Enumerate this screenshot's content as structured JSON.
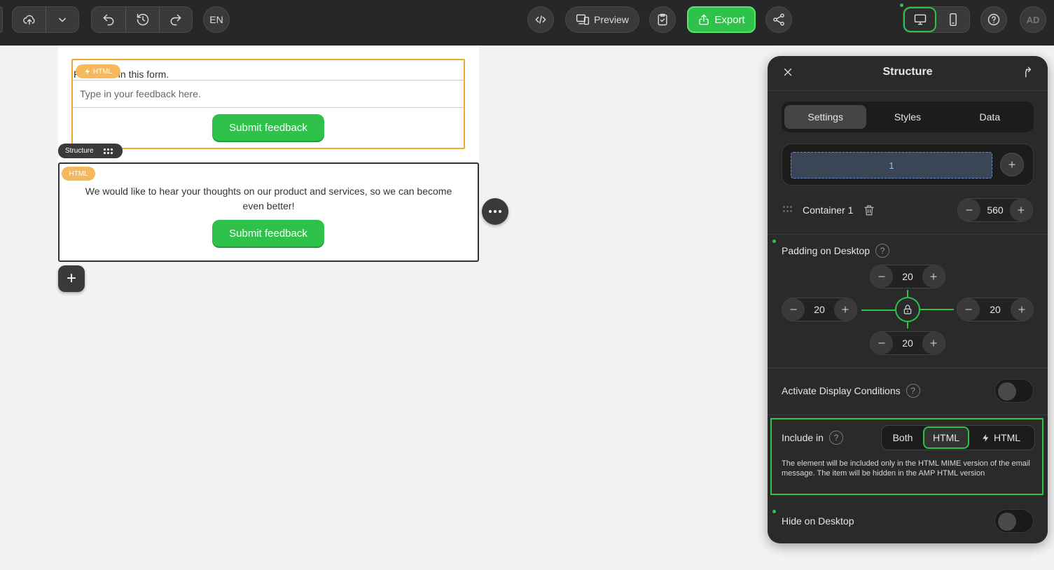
{
  "toolbar": {
    "language": "EN",
    "preview_label": "Preview",
    "export_label": "Export",
    "avatar_initials": "AD"
  },
  "canvas": {
    "block1": {
      "intro_text": "Please fill in this form.",
      "input_placeholder": "Type in your feedback here.",
      "badge_label": "HTML",
      "button_label": "Submit feedback"
    },
    "structure_tag": "Structure",
    "block2": {
      "badge_label": "HTML",
      "text": "We would like to hear your thoughts on our product and services, so we can become even better!",
      "button_label": "Submit feedback"
    }
  },
  "panel": {
    "title": "Structure",
    "tabs": [
      "Settings",
      "Styles",
      "Data"
    ],
    "active_tab": "Settings",
    "column_slot_label": "1",
    "container_label": "Container 1",
    "container_width": "560",
    "padding_label": "Padding on Desktop",
    "padding": {
      "top": "20",
      "left": "20",
      "right": "20",
      "bottom": "20"
    },
    "display_conditions_label": "Activate Display Conditions",
    "include_label": "Include in",
    "include_options": [
      "Both",
      "HTML",
      "HTML"
    ],
    "include_selected": "HTML",
    "include_description": "The element will be included only in the HTML MIME version of the email message. The item will be hidden in the AMP HTML version",
    "hide_desktop_label": "Hide on Desktop"
  },
  "colors": {
    "accent_green": "#2ec24a",
    "selection_orange": "#f0a832",
    "badge_orange": "#f5b85c",
    "topbar_bg": "#272727",
    "panel_bg": "#2a2a2a"
  }
}
